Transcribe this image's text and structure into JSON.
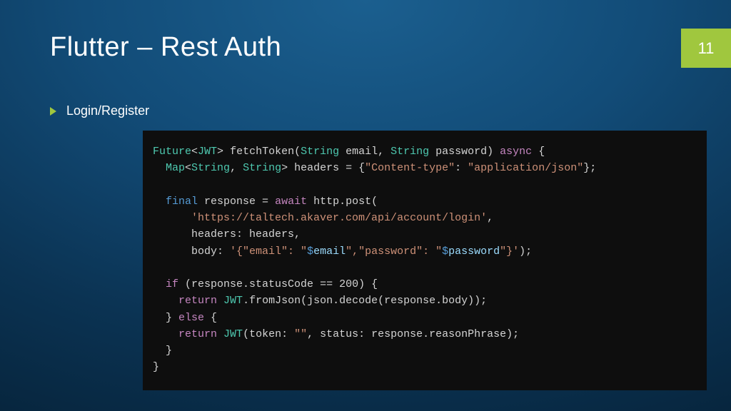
{
  "slide": {
    "title": "Flutter – Rest Auth",
    "page_number": "11",
    "bullet": "Login/Register"
  },
  "code": {
    "t_future": "Future",
    "lt1": "<",
    "t_jwt": "JWT",
    "gt1": "> ",
    "fn_fetch": "fetchToken",
    "lp1": "(",
    "t_string1": "String",
    "sp_email": " email, ",
    "t_string2": "String",
    "sp_pass": " password) ",
    "kw_async": "async",
    "ob1": " {",
    "ind2": "  ",
    "t_map": "Map",
    "lt2": "<",
    "t_string3": "String",
    "comma1": ", ",
    "t_string4": "String",
    "gt2": "> headers = {",
    "s_ctk": "\"Content-type\"",
    "colon1": ": ",
    "s_ctv": "\"application/json\"",
    "cb1": "};",
    "blank": "",
    "ind2b": "  ",
    "kw_final": "final",
    "resp_eq": " response = ",
    "kw_await": "await",
    "post": " http.post(",
    "ind6": "      ",
    "s_url": "'https://taltech.akaver.com/api/account/login'",
    "comma2": ",",
    "hdr_line": "      headers: headers,",
    "body_pre": "      body: ",
    "s_body1": "'{\"email\": \"",
    "interp1": "$",
    "v_email": "email",
    "s_body2": "\",\"password\": \"",
    "interp2": "$",
    "v_pass": "password",
    "s_body3": "\"}'",
    "rp1": ");",
    "ind2c": "  ",
    "kw_if": "if",
    "cond": " (response.statusCode == 200) {",
    "ind4": "    ",
    "kw_ret1": "return",
    "sp1": " ",
    "t_jwt2": "JWT",
    "from": ".fromJson(json.decode(response.body));",
    "ind2d": "  } ",
    "kw_else": "else",
    "ob2": " {",
    "ind4b": "    ",
    "kw_ret2": "return",
    "sp2": " ",
    "t_jwt3": "JWT",
    "ctor": "(token: ",
    "s_empty": "\"\"",
    "tail": ", status: response.reasonPhrase);",
    "close1": "  }",
    "close2": "}"
  }
}
